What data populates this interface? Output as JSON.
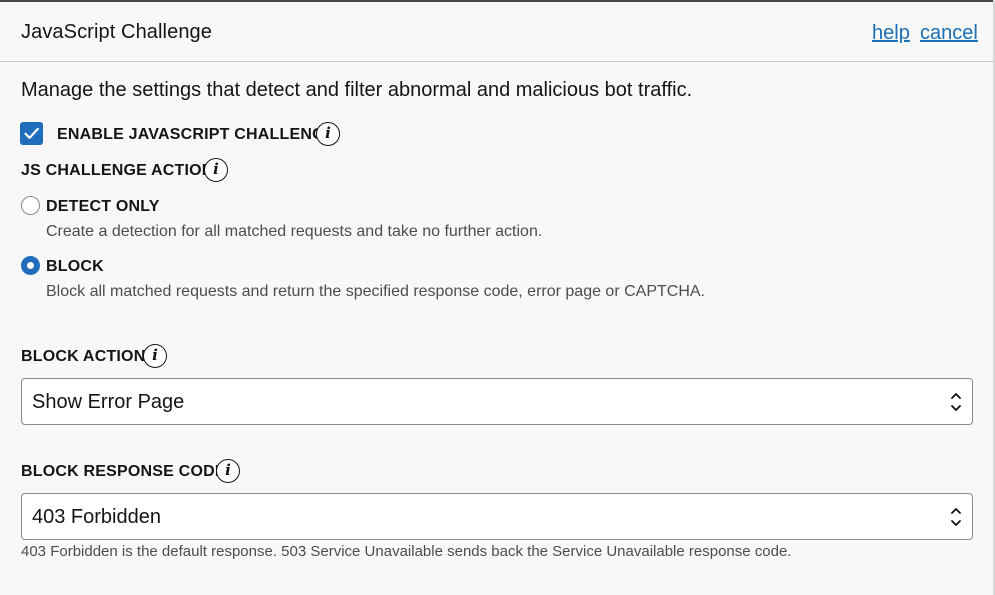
{
  "header": {
    "title": "JavaScript Challenge",
    "help_label": "help",
    "cancel_label": "cancel"
  },
  "description": "Manage the settings that detect and filter abnormal and malicious bot traffic.",
  "enable_challenge": {
    "label": "ENABLE JAVASCRIPT CHALLENGE",
    "checked": true
  },
  "js_action": {
    "label": "JS CHALLENGE ACTION",
    "options": [
      {
        "label": "DETECT ONLY",
        "description": "Create a detection for all matched requests and take no further action.",
        "selected": false
      },
      {
        "label": "BLOCK",
        "description": "Block all matched requests and return the specified response code, error page or CAPTCHA.",
        "selected": true
      }
    ]
  },
  "block_action": {
    "label": "BLOCK ACTION",
    "value": "Show Error Page"
  },
  "block_response_code": {
    "label": "BLOCK RESPONSE CODE",
    "value": "403 Forbidden",
    "hint": "403 Forbidden is the default response. 503 Service Unavailable sends back the Service Unavailable response code."
  },
  "icons": [
    "info-icon",
    "checkmark-icon",
    "select-chevron-icon"
  ],
  "colors": {
    "accent": "#1f6dbb",
    "link": "#1a6fb5",
    "background": "#f8f8f8"
  }
}
